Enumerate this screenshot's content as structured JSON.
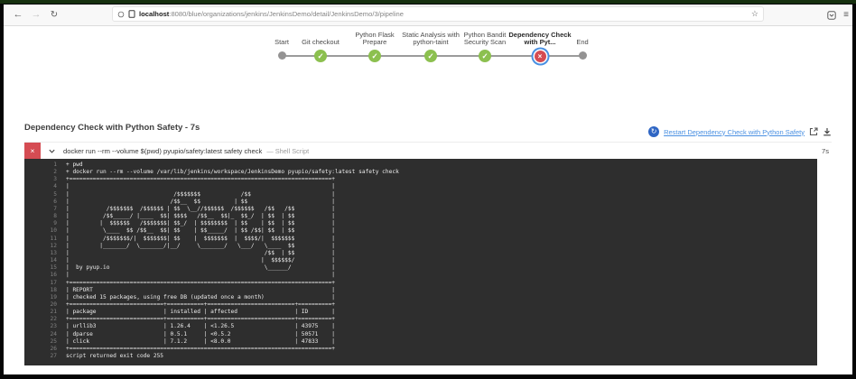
{
  "browser": {
    "url_host": "localhost",
    "url_rest": ":8080/blue/organizations/jenkins/JenkinsDemo/detail/JenkinsDemo/3/pipeline"
  },
  "icons": {
    "back": "←",
    "forward": "→",
    "reload": "↻",
    "star": "☆",
    "menu": "≡",
    "check": "✓",
    "cross": "×",
    "restart": "↻"
  },
  "pipeline": {
    "stages": [
      {
        "label": "Start",
        "status": "neutral"
      },
      {
        "label": "Git checkout",
        "status": "success"
      },
      {
        "label": "Python Flask Prepare",
        "status": "success"
      },
      {
        "label": "Static Analysis with python-taint",
        "status": "success"
      },
      {
        "label": "Python Bandit Security Scan",
        "status": "success"
      },
      {
        "label": "Dependency Check with Pyt...",
        "status": "failure",
        "selected": true
      },
      {
        "label": "End",
        "status": "neutral"
      }
    ]
  },
  "step": {
    "title": "Dependency Check with Python Safety - 7s",
    "restart_label": "Restart Dependency Check with Python Safety",
    "command": "docker run --rm --volume $(pwd) pyupio/safety:latest safety check",
    "script_type": "— Shell Script",
    "duration": "7s"
  },
  "console": {
    "line_numbers": "1\n2\n3\n4\n5\n6\n7\n8\n9\n10\n11\n12\n13\n14\n15\n16\n17\n18\n19\n20\n21\n22\n23\n24\n25\n26\n27",
    "text": "+ pwd\n+ docker run --rm --volume /var/lib/jenkins/workspace/JenkinsDemo pyupio/safety:latest safety check\n+==============================================================================+\n|                                                                              |\n|                               /$$$$$$$            /$$                        |\n|                              /$$__  $$          | $$                         |\n|           /$$$$$$$  /$$$$$$ | $$  \\__//$$$$$$  /$$$$$$   /$$   /$$           |\n|          /$$_____/ |____  $$| $$$$   /$$__  $$|_  $$_/  | $$  | $$           |\n|         |  $$$$$$   /$$$$$$$| $$_/  | $$$$$$$$  | $$    | $$  | $$           |\n|          \\____  $$ /$$__  $$| $$    | $$_____/  | $$ /$$| $$  | $$           |\n|          /$$$$$$$/|  $$$$$$$| $$    |  $$$$$$$  |  $$$$/|  $$$$$$$           |\n|         |_______/  \\_______/|__/     \\_______/   \\___/   \\____  $$           |\n|                                                          /$$  | $$           |\n|                                                         |  $$$$$$/           |\n|  by pyup.io                                              \\______/            |\n|                                                                              |\n+==============================================================================+\n| REPORT                                                                       |\n| checked 15 packages, using free DB (updated once a month)                    |\n+============================+===========+==========================+==========+\n| package                    | installed | affected                 | ID       |\n+============================+===========+==========================+==========+\n| urllib3                    | 1.26.4    | <1.26.5                  | 43975    |\n| dparse                     | 0.5.1     | <0.5.2                   | 50571    |\n| click                      | 7.1.2     | <8.0.0                   | 47833    |\n+==============================================================================+\nscript returned exit code 255"
  }
}
